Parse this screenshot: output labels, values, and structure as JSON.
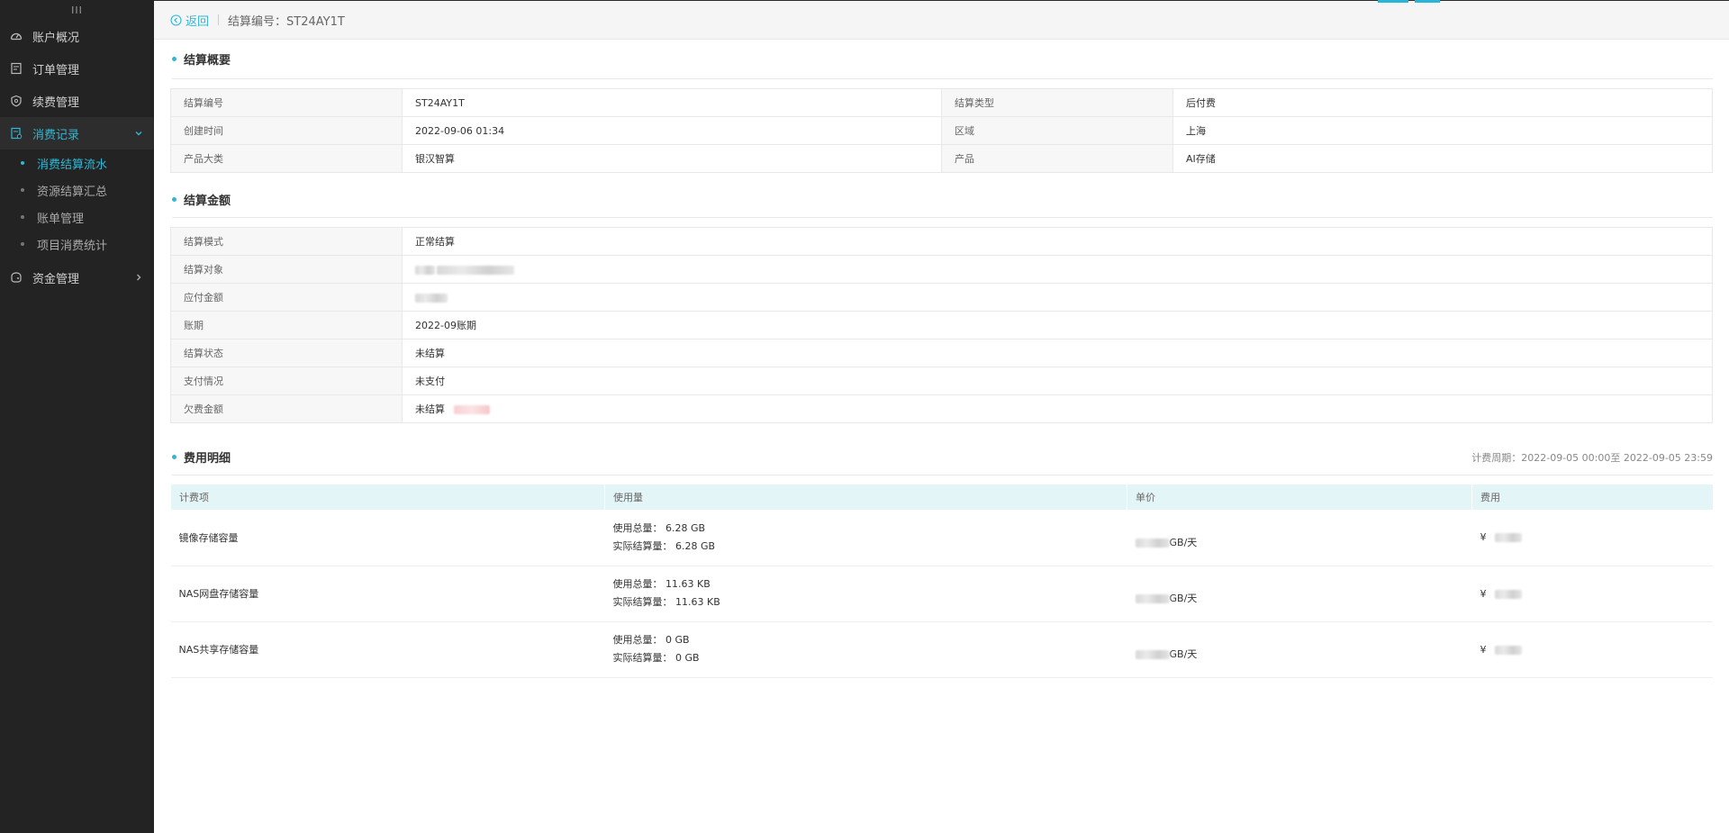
{
  "sidebar": {
    "toggle": "III",
    "items": [
      {
        "label": "账户概况",
        "icon": "dashboard-icon"
      },
      {
        "label": "订单管理",
        "icon": "order-icon"
      },
      {
        "label": "续费管理",
        "icon": "renew-icon"
      },
      {
        "label": "消费记录",
        "icon": "record-icon"
      },
      {
        "label": "资金管理",
        "icon": "wallet-icon"
      }
    ],
    "sub_items": [
      {
        "label": "消费结算流水"
      },
      {
        "label": "资源结算汇总"
      },
      {
        "label": "账单管理"
      },
      {
        "label": "项目消费统计"
      }
    ]
  },
  "topbar": {
    "back_label": "返回",
    "settlement_id_label": "结算编号：ST24AY1T"
  },
  "overview": {
    "title": "结算概要",
    "rows": [
      {
        "l1": "结算编号",
        "v1": "ST24AY1T",
        "l2": "结算类型",
        "v2": "后付费"
      },
      {
        "l1": "创建时间",
        "v1": "2022-09-06 01:34",
        "l2": "区域",
        "v2": "上海"
      },
      {
        "l1": "产品大类",
        "v1": "银汉智算",
        "l2": "产品",
        "v2": "AI存储"
      }
    ]
  },
  "amount": {
    "title": "结算金额",
    "rows": [
      {
        "label": "结算模式",
        "value": "正常结算"
      },
      {
        "label": "结算对象",
        "value": ""
      },
      {
        "label": "应付金额",
        "value": ""
      },
      {
        "label": "账期",
        "value": "2022-09账期"
      },
      {
        "label": "结算状态",
        "value": "未结算"
      },
      {
        "label": "支付情况",
        "value": "未支付"
      },
      {
        "label": "欠费金额",
        "value": "未结算"
      }
    ]
  },
  "fees": {
    "title": "费用明细",
    "period": "计费周期：2022-09-05 00:00至 2022-09-05 23:59",
    "headers": [
      "计费项",
      "使用量",
      "单价",
      "费用"
    ],
    "rows": [
      {
        "item": "镜像存储容量",
        "total": "使用总量：  6.28 GB",
        "actual": "实际结算量：  6.28 GB",
        "unit": "GB/天",
        "currency": "¥"
      },
      {
        "item": "NAS网盘存储容量",
        "total": "使用总量：  11.63 KB",
        "actual": "实际结算量：  11.63 KB",
        "unit": "GB/天",
        "currency": "¥"
      },
      {
        "item": "NAS共享存储容量",
        "total": "使用总量：  0 GB",
        "actual": "实际结算量：  0 GB",
        "unit": "GB/天",
        "currency": "¥"
      }
    ]
  }
}
